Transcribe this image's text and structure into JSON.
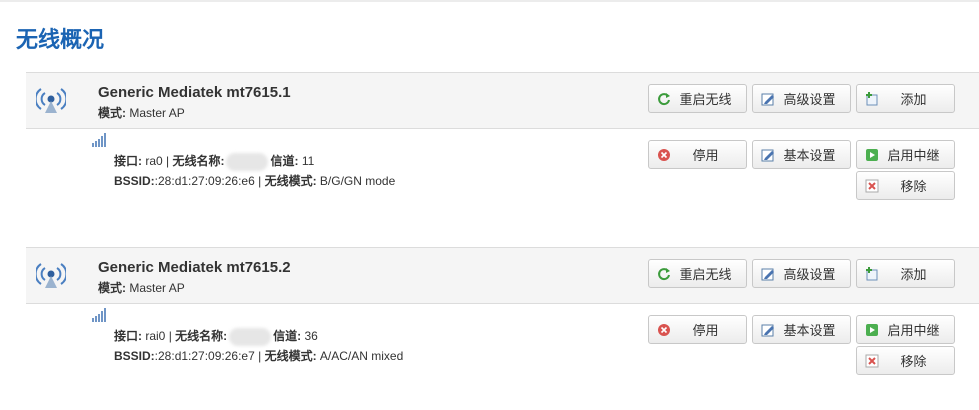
{
  "page": {
    "title": "无线概况"
  },
  "devices": [
    {
      "name": "Generic Mediatek mt7615.1",
      "mode_label": "模式:",
      "mode_value": "Master AP",
      "buttons": {
        "restart": "重启无线",
        "advanced": "高级设置",
        "add": "添加"
      },
      "network": {
        "iface_label": "接口:",
        "iface_value": "ra0",
        "ssid_label": "无线名称:",
        "channel_label": "信道:",
        "channel_value": "11",
        "bssid_label": "BSSID:",
        "bssid_value": ":28:d1:27:09:26:e6",
        "wmode_label": "无线模式:",
        "wmode_value": "B/G/GN mode",
        "buttons": {
          "disable": "停用",
          "basic": "基本设置",
          "relay": "启用中继",
          "remove": "移除"
        }
      }
    },
    {
      "name": "Generic Mediatek mt7615.2",
      "mode_label": "模式:",
      "mode_value": "Master AP",
      "buttons": {
        "restart": "重启无线",
        "advanced": "高级设置",
        "add": "添加"
      },
      "network": {
        "iface_label": "接口:",
        "iface_value": "rai0",
        "ssid_label": "无线名称:",
        "channel_label": "信道:",
        "channel_value": "36",
        "bssid_label": "BSSID:",
        "bssid_value": ":28:d1:27:09:26:e7",
        "wmode_label": "无线模式:",
        "wmode_value": "A/AC/AN mixed",
        "buttons": {
          "disable": "停用",
          "basic": "基本设置",
          "relay": "启用中继",
          "remove": "移除"
        }
      }
    }
  ],
  "colors": {
    "title": "#1b64b3",
    "header_bg": "#f5f5f5"
  },
  "icons": [
    "wireless-radio-icon",
    "signal-strength-icon",
    "refresh-icon",
    "edit-icon",
    "add-icon",
    "stop-icon",
    "play-icon",
    "delete-icon"
  ]
}
